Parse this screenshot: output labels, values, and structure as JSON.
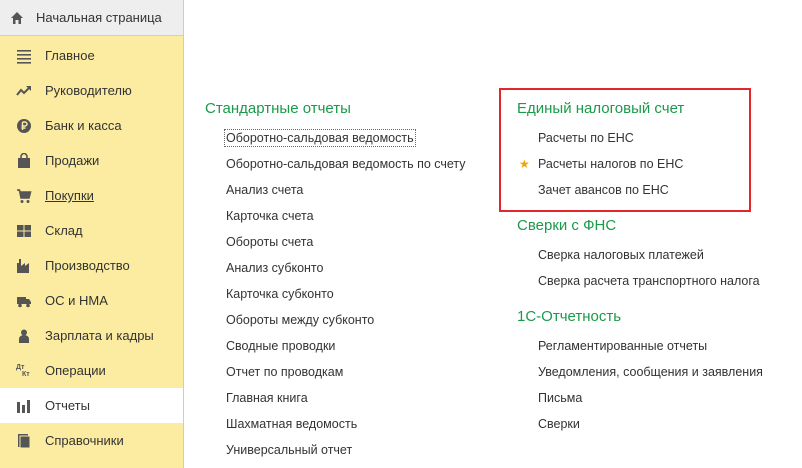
{
  "sidebar": {
    "home_label": "Начальная страница",
    "items": [
      {
        "label": "Главное",
        "icon": "menu-lines-icon"
      },
      {
        "label": "Руководителю",
        "icon": "trend-icon"
      },
      {
        "label": "Банк и касса",
        "icon": "coin-icon"
      },
      {
        "label": "Продажи",
        "icon": "shopping-bag-icon"
      },
      {
        "label": "Покупки",
        "icon": "cart-icon"
      },
      {
        "label": "Склад",
        "icon": "warehouse-icon"
      },
      {
        "label": "Производство",
        "icon": "factory-icon"
      },
      {
        "label": "ОС и НМА",
        "icon": "truck-icon"
      },
      {
        "label": "Зарплата и кадры",
        "icon": "person-icon"
      },
      {
        "label": "Операции",
        "icon": "dt-kt-icon"
      },
      {
        "label": "Отчеты",
        "icon": "bar-chart-icon"
      },
      {
        "label": "Справочники",
        "icon": "book-icon"
      }
    ],
    "dtkt_top": "Дт",
    "dtkt_bottom": "Кт"
  },
  "standard_reports": {
    "title": "Стандартные отчеты",
    "items": [
      "Оборотно-сальдовая ведомость",
      "Оборотно-сальдовая ведомость по счету",
      "Анализ счета",
      "Карточка счета",
      "Обороты счета",
      "Анализ субконто",
      "Карточка субконто",
      "Обороты между субконто",
      "Сводные проводки",
      "Отчет по проводкам",
      "Главная книга",
      "Шахматная ведомость",
      "Универсальный отчет"
    ]
  },
  "ens": {
    "title": "Единый налоговый счет",
    "items": [
      "Расчеты по ЕНС",
      "Расчеты налогов по ЕНС",
      "Зачет авансов по ЕНС"
    ]
  },
  "fns": {
    "title": "Сверки с ФНС",
    "items": [
      "Сверка налоговых платежей",
      "Сверка расчета транспортного налога"
    ]
  },
  "reporting": {
    "title": "1С-Отчетность",
    "items": [
      "Регламентированные отчеты",
      "Уведомления, сообщения и заявления",
      "Письма",
      "Сверки"
    ]
  },
  "colors": {
    "sidebar_bg": "#fbeca1",
    "section_title": "#1a9a4a",
    "highlight_border": "#e3262c",
    "star": "#f0a30a"
  }
}
